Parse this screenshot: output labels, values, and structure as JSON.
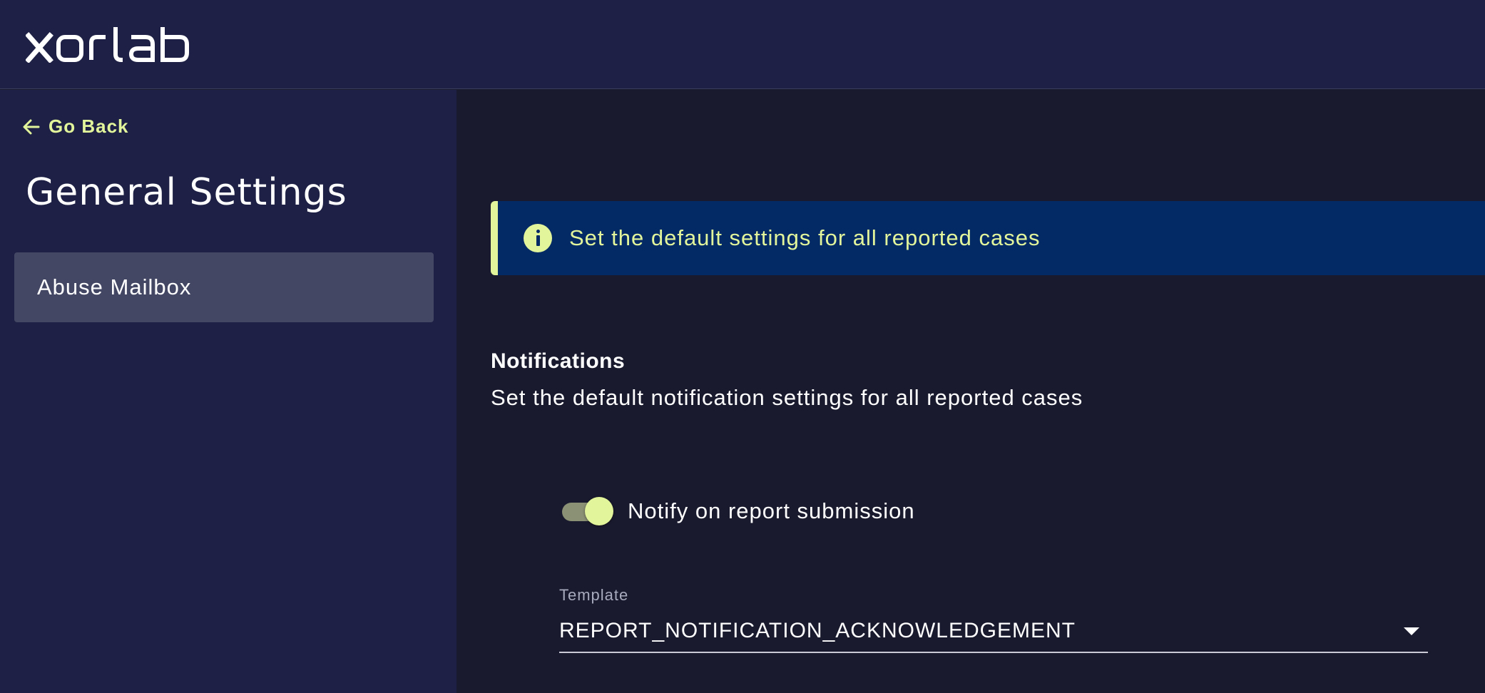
{
  "header": {
    "logo_text": "xorlab"
  },
  "sidebar": {
    "go_back_label": "Go Back",
    "title": "General Settings",
    "items": [
      {
        "label": "Abuse Mailbox",
        "selected": true
      }
    ]
  },
  "main": {
    "info_banner": {
      "icon": "info-icon",
      "text": "Set the default settings for all reported cases"
    },
    "notifications": {
      "title": "Notifications",
      "description": "Set the default notification settings for all reported cases",
      "toggle": {
        "label": "Notify on report submission",
        "checked": true
      },
      "template": {
        "label": "Template",
        "value": "REPORT_NOTIFICATION_ACKNOWLEDGEMENT"
      }
    }
  },
  "colors": {
    "accent": "#e3f59b",
    "header_bg": "#1e2145",
    "main_bg": "#1a1a2e",
    "banner_bg": "#042a66",
    "selected_item_bg": "#444764"
  }
}
